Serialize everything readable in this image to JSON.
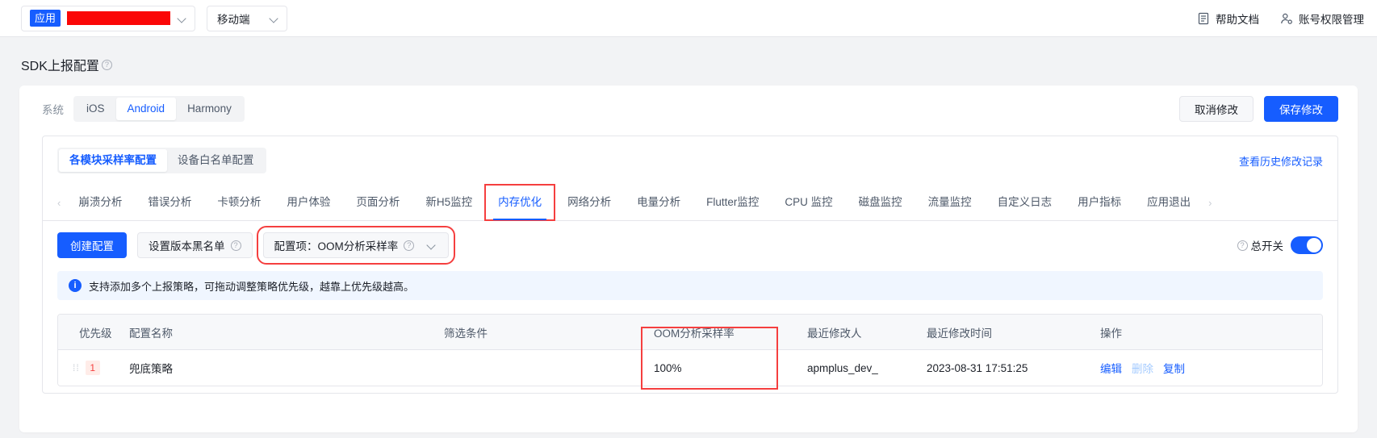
{
  "topbar": {
    "app_tag": "应用",
    "app_value_redacted": true,
    "platform": "移动端",
    "help_label": "帮助文档",
    "account_label": "账号权限管理",
    "help_icon": "document-icon",
    "account_icon": "user-settings-icon"
  },
  "page": {
    "title": "SDK上报配置",
    "title_help_icon": "question-circle-icon"
  },
  "system": {
    "label": "系统",
    "options": [
      "iOS",
      "Android",
      "Harmony"
    ],
    "selected": "Android",
    "cancel_label": "取消修改",
    "save_label": "保存修改"
  },
  "inner": {
    "segments": [
      "各模块采样率配置",
      "设备白名单配置"
    ],
    "selected_segment": "各模块采样率配置",
    "history_link": "查看历史修改记录"
  },
  "tabs": {
    "prev_icon": "chevron-left-icon",
    "next_icon": "chevron-right-icon",
    "items": [
      "崩溃分析",
      "错误分析",
      "卡顿分析",
      "用户体验",
      "页面分析",
      "新H5监控",
      "内存优化",
      "网络分析",
      "电量分析",
      "Flutter监控",
      "CPU 监控",
      "磁盘监控",
      "流量监控",
      "自定义日志",
      "用户指标",
      "应用退出"
    ],
    "active": "内存优化"
  },
  "actions": {
    "create_label": "创建配置",
    "blacklist_label": "设置版本黑名单",
    "blacklist_help_icon": "question-circle-icon",
    "config_item_label": "配置项：OOM分析采样率",
    "config_item_help_icon": "question-circle-icon",
    "config_item_chevron": "chevron-down-icon",
    "master_switch_label": "总开关",
    "master_switch_help_icon": "question-circle-icon",
    "master_switch_on": true
  },
  "banner": {
    "icon": "info-icon",
    "text": "支持添加多个上报策略，可拖动调整策略优先级，越靠上优先级越高。"
  },
  "table": {
    "columns": [
      "优先级",
      "配置名称",
      "筛选条件",
      "OOM分析采样率",
      "最近修改人",
      "最近修改时间",
      "操作"
    ],
    "rows": [
      {
        "drag_handle": "drag-handle-icon",
        "priority": "1",
        "name": "兜底策略",
        "filter": "",
        "rate": "100%",
        "editor": "apmplus_dev_",
        "time": "2023-08-31 17:51:25",
        "ops": [
          {
            "label": "编辑",
            "enabled": true
          },
          {
            "label": "删除",
            "enabled": false
          },
          {
            "label": "复制",
            "enabled": true
          }
        ]
      }
    ]
  },
  "colors": {
    "primary": "#165dff",
    "danger": "#f53f3f",
    "redaction": "#fb0707"
  }
}
